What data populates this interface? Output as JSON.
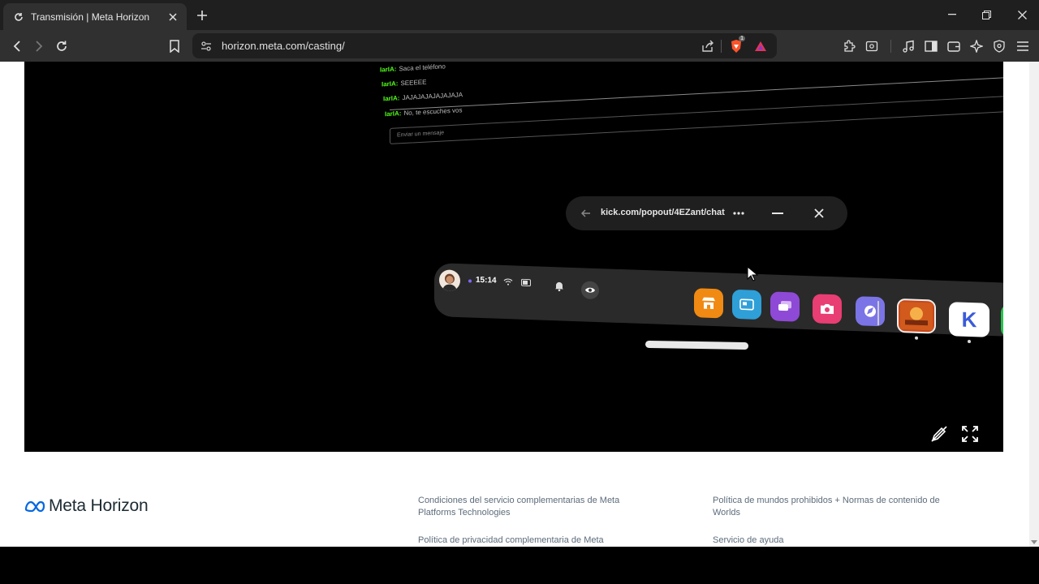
{
  "browser": {
    "tab_title": "Transmisión | Meta Horizon",
    "url": "horizon.meta.com/casting/",
    "brave_badge": "1"
  },
  "stream": {
    "chat": [
      {
        "nick": "IarIA:",
        "text": "Saca el teléfono"
      },
      {
        "nick": "IarIA:",
        "text": "SEEEEE"
      },
      {
        "nick": "IarIA:",
        "text": "JAJAJAJAJAJAJAJA"
      },
      {
        "nick": "IarIA:",
        "text": "No, te escuches vos"
      }
    ],
    "chat_placeholder": "Enviar un mensaje",
    "vr_browser_url": "kick.com/popout/4EZant/chat",
    "dock_time": "15:14",
    "apps": [
      {
        "name": "store",
        "color": "#f08a13"
      },
      {
        "name": "browser",
        "color": "#2f9fd8"
      },
      {
        "name": "chat",
        "color": "#8e4ad6"
      },
      {
        "name": "camera",
        "color": "#e83e73"
      },
      {
        "name": "explore",
        "color": "#7b74e6"
      },
      {
        "name": "game",
        "color": "#c8471b"
      },
      {
        "name": "kick",
        "color": "#ffffff",
        "letter": "K"
      },
      {
        "name": "green-app",
        "color": "#27c24c"
      }
    ]
  },
  "footer": {
    "logo": "Meta Horizon",
    "links_col1": [
      "Condiciones del servicio complementarias de Meta Platforms Technologies",
      "Política de privacidad complementaria de Meta"
    ],
    "links_col2": [
      "Política de mundos prohibidos + Normas de contenido de Worlds",
      "Servicio de ayuda"
    ]
  }
}
